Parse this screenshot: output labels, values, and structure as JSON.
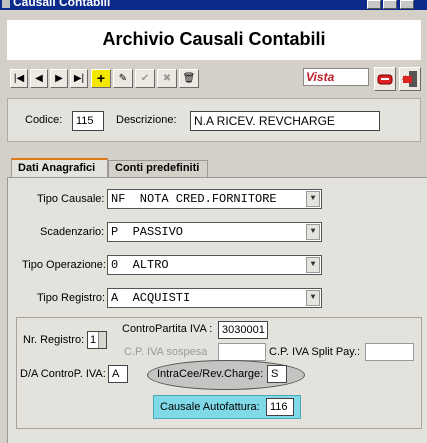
{
  "window": {
    "title": "Causali Contabili"
  },
  "header": {
    "title": "Archivio Causali Contabili"
  },
  "toolbar": {
    "first_icon": "|◀",
    "prev_icon": "◀",
    "next_icon": "▶",
    "last_icon": "▶|",
    "new_icon": "+",
    "edit_icon": "✎",
    "confirm_icon": "✔",
    "cancel_icon": "✖",
    "delete_icon": "🗑",
    "mode_label": "Vista",
    "accent_red": "#c0202a"
  },
  "record": {
    "codice_label": "Codice:",
    "codice_value": "115",
    "descrizione_label": "Descrizione:",
    "descrizione_value": "N.A RICEV. REVCHARGE"
  },
  "tabs": [
    {
      "label": "Dati Anagrafici",
      "active": true
    },
    {
      "label": "Conti predefiniti",
      "active": false
    }
  ],
  "form": {
    "tipo_causale_label": "Tipo Causale:",
    "tipo_causale_value": "NF  NOTA CRED.FORNITORE",
    "scadenzario_label": "Scadenzario:",
    "scadenzario_value": "P  PASSIVO",
    "tipo_operazione_label": "Tipo Operazione:",
    "tipo_operazione_value": "0  ALTRO",
    "tipo_registro_label": "Tipo Registro:",
    "tipo_registro_value": "A  ACQUISTI",
    "dropdown_icon": "▼"
  },
  "group": {
    "nr_registro_label": "Nr. Registro:",
    "nr_registro_value": "1",
    "contropartita_label": "ControPartita IVA :",
    "contropartita_value": "3030001",
    "cp_iva_sospesa_label": "C.P. IVA sospesa",
    "cp_iva_sospesa_value": "",
    "cp_iva_split_label": "C.P. IVA Split Pay.:",
    "cp_iva_split_value": "",
    "da_contro_label": "D/A ControP. IVA:",
    "da_contro_value": "A",
    "intracee_label": "IntraCee/Rev.Charge:",
    "intracee_value": "S",
    "causale_autofattura_label": "Causale Autofattura:",
    "causale_autofattura_value": "116"
  }
}
